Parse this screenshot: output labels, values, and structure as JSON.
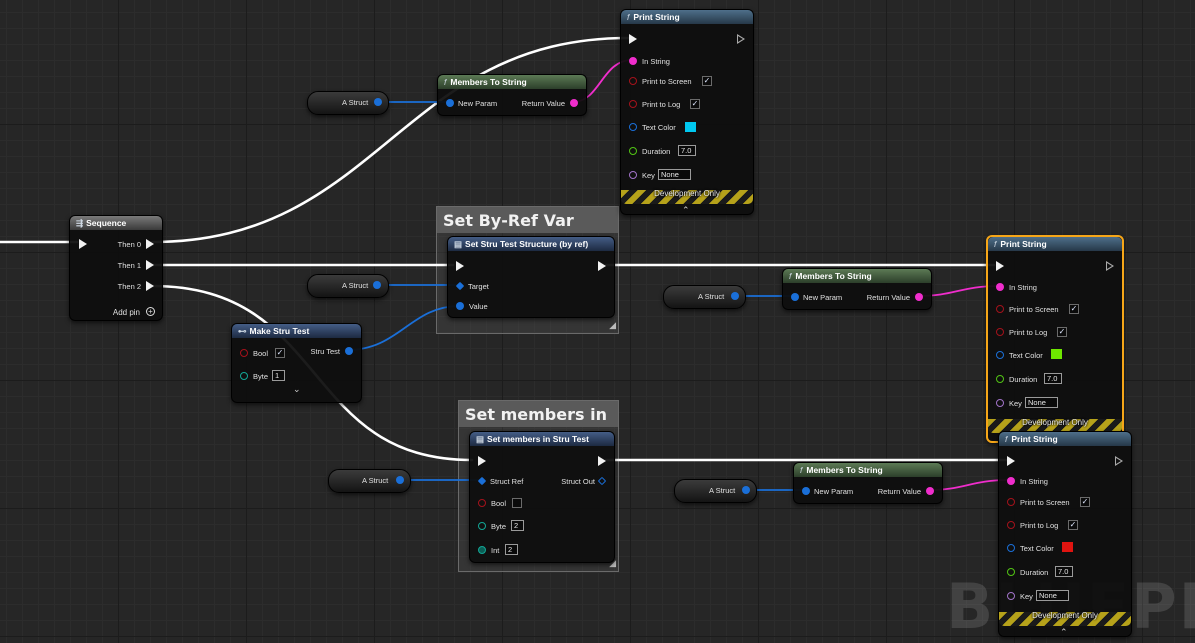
{
  "watermark": "BLUEPRINT",
  "comments": {
    "set_by_ref": "Set By-Ref Var",
    "set_members": "Set members in"
  },
  "sequence": {
    "title": "Sequence",
    "then0": "Then 0",
    "then1": "Then 1",
    "then2": "Then 2",
    "add_pin": "Add pin"
  },
  "variables": {
    "a_struct": "A Struct"
  },
  "members_to_string": {
    "title": "Members To String",
    "new_param": "New Param",
    "return_value": "Return Value"
  },
  "print_string": {
    "title": "Print String",
    "in_string": "In String",
    "print_to_screen": "Print to Screen",
    "print_to_log": "Print to Log",
    "text_color": "Text Color",
    "duration": "Duration",
    "duration_value": "7.0",
    "key": "Key",
    "key_value": "None",
    "dev_only": "Development Only"
  },
  "print_string_colors": [
    "#00c8f0",
    "#6ee600",
    "#e01410"
  ],
  "set_by_ref_node": {
    "title": "Set Stru Test Structure (by ref)",
    "target": "Target",
    "value": "Value"
  },
  "make_stru": {
    "title": "Make Stru Test",
    "bool": "Bool",
    "byte": "Byte",
    "byte_value": "1",
    "output": "Stru Test"
  },
  "set_members_node": {
    "title": "Set members in Stru Test",
    "struct_ref": "Struct Ref",
    "struct_out": "Struct Out",
    "bool": "Bool",
    "byte": "Byte",
    "byte_value": "2",
    "int": "Int",
    "int_value": "2"
  },
  "icons": {
    "function": "f",
    "sequence": "sequence-icon",
    "make": "make-struct-icon",
    "set": "variable-set-icon",
    "check": "✓",
    "chevron": "⌃",
    "expand": "⌄"
  }
}
